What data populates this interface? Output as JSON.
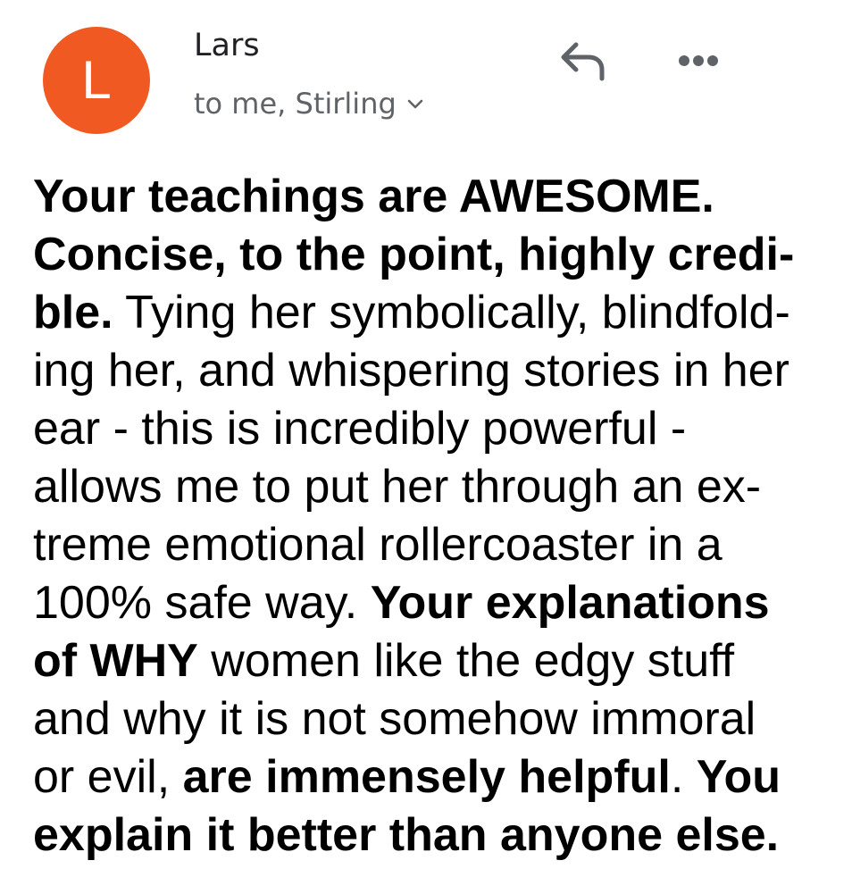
{
  "colors": {
    "avatar_bg": "#f05a22",
    "avatar_text": "#ffffff",
    "icon": "#5f6368"
  },
  "header": {
    "avatar_letter": "L",
    "sender_name": "Lars",
    "recipients": "to me, Stirling",
    "reply_icon": "reply-arrow-icon",
    "more_icon": "more-horizontal-icon",
    "expand_icon": "chevron-down-icon"
  },
  "message": {
    "lines": [
      [
        {
          "t": "Your teachings are AWESOME.",
          "b": true
        }
      ],
      [
        {
          "t": "Concise, to the point, highly credi-",
          "b": true
        }
      ],
      [
        {
          "t": "ble.",
          "b": true
        },
        {
          "t": " Tying her symbolically, blindfold-",
          "b": false
        }
      ],
      [
        {
          "t": "ing her, and whispering stories in her",
          "b": false
        }
      ],
      [
        {
          "t": "ear - this is incredibly powerful -",
          "b": false
        }
      ],
      [
        {
          "t": "allows me to put her through an ex-",
          "b": false
        }
      ],
      [
        {
          "t": "treme emotional rollercoaster in a",
          "b": false
        }
      ],
      [
        {
          "t": "100% safe way. ",
          "b": false
        },
        {
          "t": "Your explanations",
          "b": true
        }
      ],
      [
        {
          "t": "of WHY",
          "b": true
        },
        {
          "t": " women like the edgy stuff",
          "b": false
        }
      ],
      [
        {
          "t": "and why it is not somehow immoral",
          "b": false
        }
      ],
      [
        {
          "t": "or evil, ",
          "b": false
        },
        {
          "t": "are immensely helpful",
          "b": true
        },
        {
          "t": ". ",
          "b": false
        },
        {
          "t": "You",
          "b": true
        }
      ],
      [
        {
          "t": "explain it better than anyone else.",
          "b": true
        }
      ]
    ]
  }
}
